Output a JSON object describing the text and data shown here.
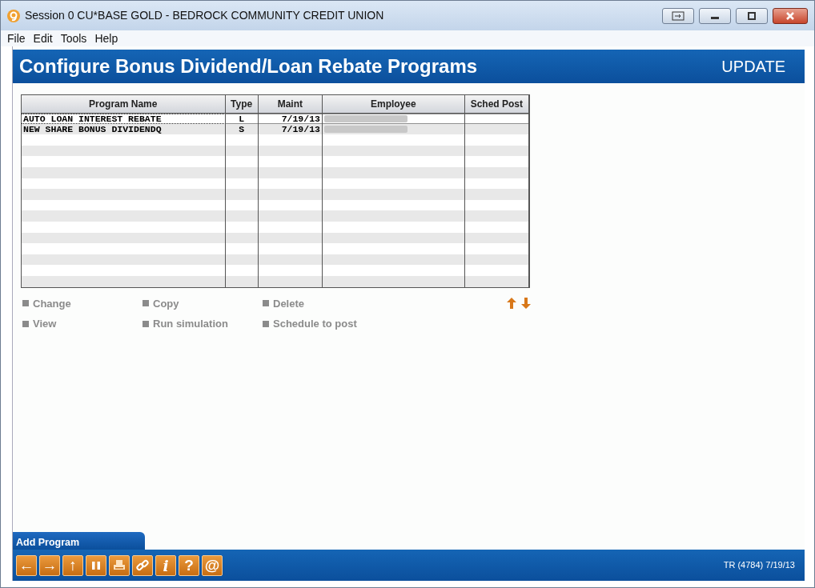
{
  "window": {
    "title": "Session 0 CU*BASE GOLD - BEDROCK COMMUNITY CREDIT UNION"
  },
  "menu": [
    "File",
    "Edit",
    "Tools",
    "Help"
  ],
  "header": {
    "title": "Configure Bonus Dividend/Loan Rebate Programs",
    "mode": "UPDATE"
  },
  "table": {
    "columns": [
      "Program Name",
      "Type",
      "Maint",
      "Employee",
      "Sched Post"
    ],
    "rows": [
      {
        "program_name": "AUTO LOAN INTEREST REBATE",
        "type": "L",
        "maint": "7/19/13",
        "employee_redacted": true,
        "selected": true
      },
      {
        "program_name": "NEW SHARE BONUS DIVIDENDQ",
        "type": "S",
        "maint": "7/19/13",
        "employee_redacted": true,
        "selected": false
      }
    ]
  },
  "actions": [
    {
      "label": "Change",
      "disabled": true
    },
    {
      "label": "Copy",
      "disabled": true
    },
    {
      "label": "Delete",
      "disabled": true
    },
    {
      "label": "View",
      "disabled": true
    },
    {
      "label": "Run simulation",
      "disabled": true
    },
    {
      "label": "Schedule to post",
      "disabled": true
    }
  ],
  "bottom_tab": "Add Program",
  "toolbar": [
    {
      "kind": "glyph",
      "label": "←"
    },
    {
      "kind": "glyph",
      "label": "→"
    },
    {
      "kind": "glyph",
      "label": "↑"
    },
    {
      "kind": "pause"
    },
    {
      "kind": "print"
    },
    {
      "kind": "link"
    },
    {
      "kind": "glyph",
      "label": "i"
    },
    {
      "kind": "glyph",
      "label": "?"
    },
    {
      "kind": "glyph",
      "label": "@"
    }
  ],
  "status": "TR (4784) 7/19/13"
}
